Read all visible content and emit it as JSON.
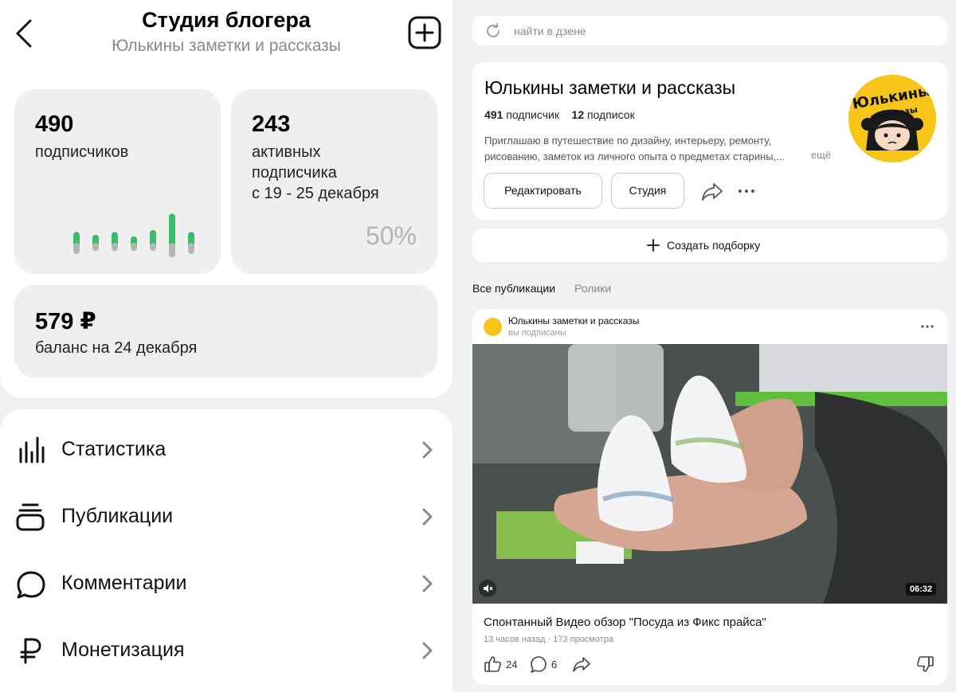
{
  "studio": {
    "title": "Студия блогера",
    "subtitle": "Юлькины заметки и рассказы"
  },
  "cards": {
    "subscribers": {
      "value": "490",
      "label": "подписчиков",
      "spark": [
        0.3,
        0.22,
        0.3,
        0.18,
        0.35,
        0.8,
        0.3
      ]
    },
    "active": {
      "value": "243",
      "label_lines": [
        "активных",
        "подписчика",
        "с 19 - 25 декабря"
      ],
      "percent": "50%"
    },
    "balance": {
      "value": "579 ₽",
      "label": "баланс на 24 декабря"
    }
  },
  "menu": [
    {
      "label": "Статистика",
      "icon": "bar-chart-icon"
    },
    {
      "label": "Публикации",
      "icon": "publications-icon"
    },
    {
      "label": "Комментарии",
      "icon": "comment-icon"
    },
    {
      "label": "Монетизация",
      "icon": "ruble-icon"
    }
  ],
  "search": {
    "placeholder": "найти в дзене"
  },
  "profile": {
    "name": "Юлькины заметки и рассказы",
    "subscribers_count": "491",
    "subscribers_label": "подписчик",
    "subscriptions_count": "12",
    "subscriptions_label": "подписок",
    "description": "Приглашаю в путешествие по дизайну, интерьеру, ремонту, рисованию, заметок из личного опыта о предметах старины,...",
    "more": "ещё",
    "avatar_text_top": "Юлькины",
    "avatar_text_bottom": "рассказы",
    "edit_button": "Редактировать",
    "studio_button": "Студия"
  },
  "create_collection": "Создать подборку",
  "tabs": [
    "Все публикации",
    "Ролики"
  ],
  "post": {
    "author": "Юлькины заметки и рассказы",
    "status": "вы подписаны",
    "duration": "06:32",
    "title": "Спонтанный Видео обзор \"Посуда из Фикс прайса\"",
    "meta": "13 часов назад · 173 просмотра",
    "likes": "24",
    "comments": "6"
  },
  "colors": {
    "accent_green": "#3dbb6b",
    "avatar_yellow": "#f6c518"
  }
}
